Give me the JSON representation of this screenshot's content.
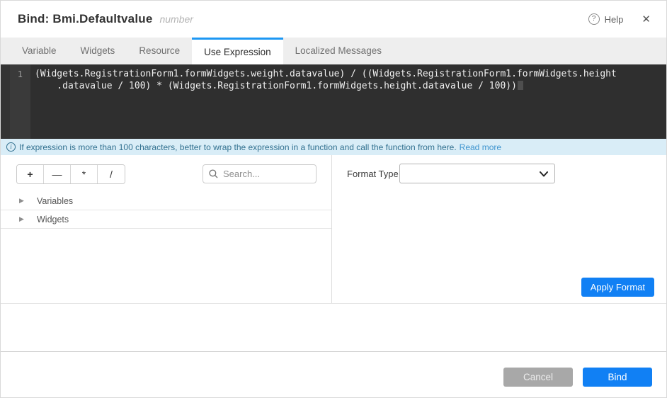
{
  "header": {
    "title": "Bind: Bmi.Defaultvalue",
    "subtitle": "number",
    "help_icon_glyph": "?",
    "help_label": "Help",
    "close_glyph": "✕"
  },
  "tabs": {
    "items": [
      {
        "label": "Variable",
        "active": false
      },
      {
        "label": "Widgets",
        "active": false
      },
      {
        "label": "Resource",
        "active": false
      },
      {
        "label": "Use Expression",
        "active": true
      },
      {
        "label": "Localized Messages",
        "active": false
      }
    ]
  },
  "editor": {
    "line_number": "1",
    "lines": [
      "(Widgets.RegistrationForm1.formWidgets.weight.datavalue) / ((Widgets.RegistrationForm1.formWidgets.height",
      "    .datavalue / 100) * (Widgets.RegistrationForm1.formWidgets.height.datavalue / 100))"
    ]
  },
  "info_bar": {
    "icon_glyph": "i",
    "message": "If expression is more than 100 characters, better to wrap the expression in a function and call the function from here.",
    "link_label": "Read more"
  },
  "toolbar": {
    "operators": [
      "+",
      "—",
      "*",
      "/"
    ]
  },
  "search": {
    "placeholder": "Search..."
  },
  "tree": {
    "items": [
      {
        "label": "Variables"
      },
      {
        "label": "Widgets"
      }
    ]
  },
  "format": {
    "label": "Format Type",
    "selected_value": "",
    "apply_label": "Apply Format"
  },
  "footer": {
    "cancel_label": "Cancel",
    "bind_label": "Bind"
  },
  "colors": {
    "accent_blue": "#1180f4",
    "tab_active_border": "#1d97f3",
    "editor_bg": "#2f2f2f",
    "info_bg": "#d9edf7",
    "info_text": "#31708f",
    "cancel_gray": "#a8a8a8"
  }
}
